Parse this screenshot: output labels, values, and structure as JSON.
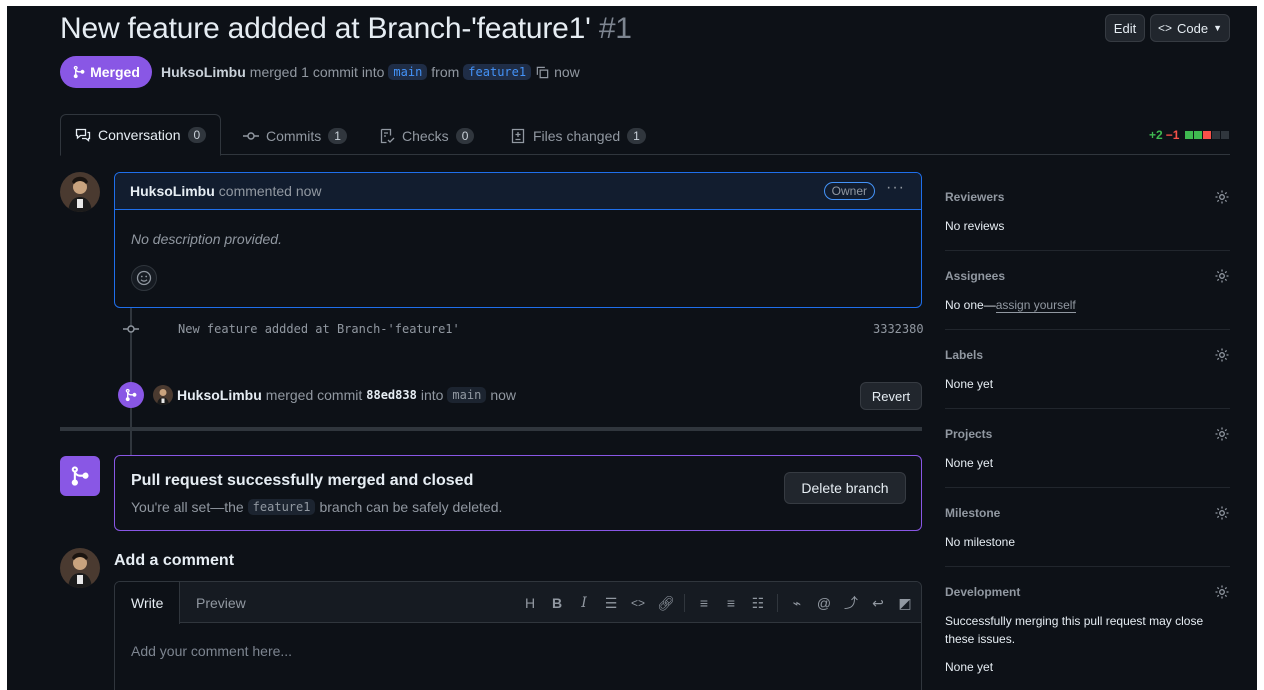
{
  "header": {
    "title": "New feature addded at Branch-'feature1'",
    "number": "#1",
    "edit_label": "Edit",
    "code_label": "Code",
    "status_label": "Merged",
    "author": "HuksoLimbu",
    "merge_text": "merged 1 commit into",
    "base_branch": "main",
    "from_text": "from",
    "head_branch": "feature1",
    "time": "now"
  },
  "tabs": [
    {
      "label": "Conversation",
      "count": "0"
    },
    {
      "label": "Commits",
      "count": "1"
    },
    {
      "label": "Checks",
      "count": "0"
    },
    {
      "label": "Files changed",
      "count": "1"
    }
  ],
  "diffstat": {
    "added": "+2",
    "removed": "−1"
  },
  "comment": {
    "author": "HuksoLimbu",
    "action": "commented now",
    "role": "Owner",
    "body": "No description provided."
  },
  "commit": {
    "message": "New feature addded at Branch-'feature1'",
    "sha": "3332380"
  },
  "merge_event": {
    "author": "HuksoLimbu",
    "text": "merged commit",
    "commit": "88ed838",
    "into": "into",
    "branch": "main",
    "time": "now",
    "revert_label": "Revert"
  },
  "merged_box": {
    "title": "Pull request successfully merged and closed",
    "sub_before": "You're all set—the",
    "branch": "feature1",
    "sub_after": "branch can be safely deleted.",
    "delete_label": "Delete branch"
  },
  "editor": {
    "heading": "Add a comment",
    "write_tab": "Write",
    "preview_tab": "Preview",
    "placeholder": "Add your comment here..."
  },
  "sidebar": {
    "reviewers": {
      "title": "Reviewers",
      "value": "No reviews"
    },
    "assignees": {
      "title": "Assignees",
      "value": "No one—",
      "link": "assign yourself"
    },
    "labels": {
      "title": "Labels",
      "value": "None yet"
    },
    "projects": {
      "title": "Projects",
      "value": "None yet"
    },
    "milestone": {
      "title": "Milestone",
      "value": "No milestone"
    },
    "development": {
      "title": "Development",
      "value": "Successfully merging this pull request may close these issues.",
      "value2": "None yet"
    }
  },
  "colors": {
    "merged": "#8957e5",
    "accent": "#1f6feb",
    "added": "#3fb950",
    "removed": "#f85149"
  }
}
